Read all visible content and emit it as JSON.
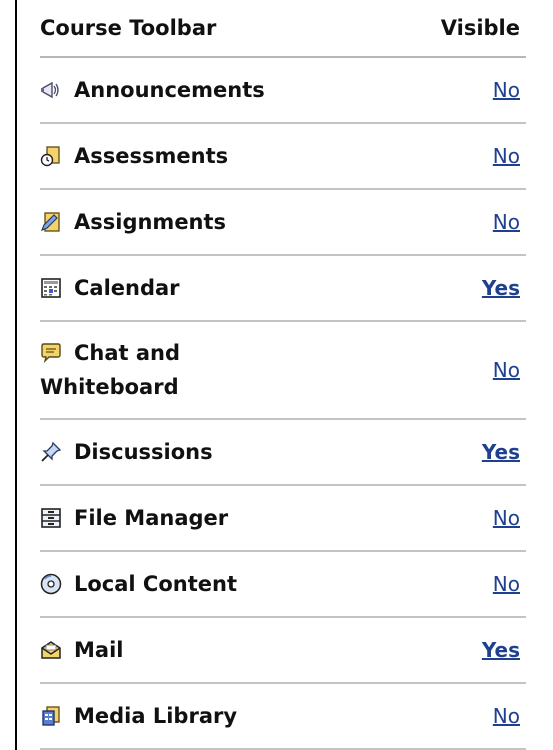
{
  "header": {
    "left": "Course Toolbar",
    "right": "Visible"
  },
  "rows": [
    {
      "label": "Announcements",
      "value": "No",
      "icon": "megaphone-icon"
    },
    {
      "label": "Assessments",
      "value": "No",
      "icon": "clipboard-clock-icon"
    },
    {
      "label": "Assignments",
      "value": "No",
      "icon": "folder-pencil-icon"
    },
    {
      "label": "Calendar",
      "value": "Yes",
      "icon": "calendar-icon"
    },
    {
      "label_line1": "Chat and",
      "label_line2": "Whiteboard",
      "value": "No",
      "icon": "speech-bubble-icon"
    },
    {
      "label": "Discussions",
      "value": "Yes",
      "icon": "pushpin-icon"
    },
    {
      "label": "File Manager",
      "value": "No",
      "icon": "file-cabinet-icon"
    },
    {
      "label": "Local Content",
      "value": "No",
      "icon": "cd-disc-icon"
    },
    {
      "label": "Mail",
      "value": "Yes",
      "icon": "envelope-icon"
    },
    {
      "label": "Media Library",
      "value": "No",
      "icon": "media-book-icon"
    }
  ]
}
